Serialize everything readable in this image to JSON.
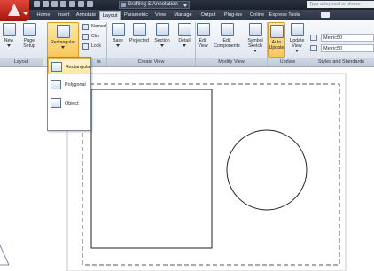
{
  "title_bar": {
    "workspace": "Drafting & Annotation",
    "search_placeholder": "Type a keyword or phrase"
  },
  "tabs": [
    {
      "label": "Home",
      "active": false
    },
    {
      "label": "Insert",
      "active": false
    },
    {
      "label": "Annotate",
      "active": false
    },
    {
      "label": "Layout",
      "active": true
    },
    {
      "label": "Parametric",
      "active": false
    },
    {
      "label": "View",
      "active": false
    },
    {
      "label": "Manage",
      "active": false
    },
    {
      "label": "Output",
      "active": false
    },
    {
      "label": "Plug-ins",
      "active": false
    },
    {
      "label": "Online",
      "active": false
    },
    {
      "label": "Express Tools",
      "active": false
    }
  ],
  "ribbon": {
    "layout_panel": {
      "title": "Layout",
      "new_label": "New",
      "page_setup_label": "Page Setup"
    },
    "viewports_panel": {
      "rectangular_label": "Rectangular",
      "named_label": "Named",
      "clip_label": "Clip",
      "lock_label": "Lock",
      "title_tail": "ts"
    },
    "create_view_panel": {
      "title": "Create View",
      "base_label": "Base",
      "projected_label": "Projected",
      "section_label": "Section",
      "detail_label": "Detail"
    },
    "modify_view_panel": {
      "title": "Modify View",
      "edit_view_label": "Edit View",
      "edit_components_label": "Edit Components",
      "symbol_sketch_label": "Symbol Sketch"
    },
    "update_panel": {
      "title": "Update",
      "auto_update_label": "Auto Update",
      "update_view_label": "Update View"
    },
    "styles_panel": {
      "title": "Styles and Standards",
      "style1": "Metric50",
      "style2": "Metric50"
    }
  },
  "viewport_dropdown": {
    "items": [
      "Rectangular",
      "Polygonal",
      "Object"
    ],
    "hovered": "Rectangular"
  },
  "colors": {
    "titlebar": "#1c212b",
    "active_tab": "#dfe4ec",
    "highlight": "#f9c65b"
  }
}
